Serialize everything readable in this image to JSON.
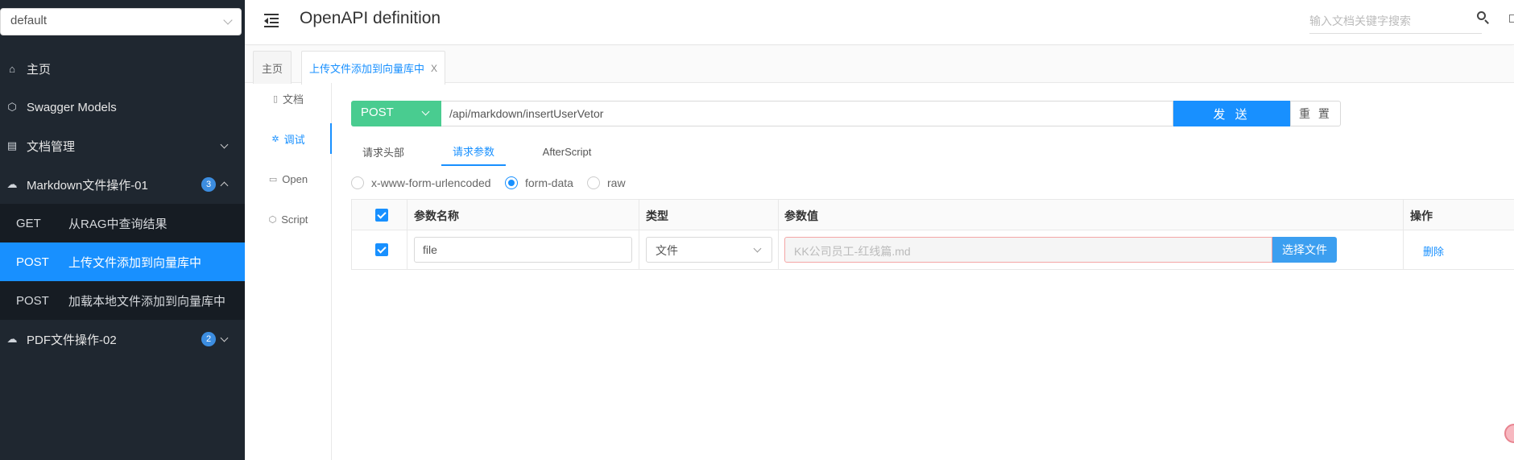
{
  "sidebar": {
    "group_select": "default",
    "menu": {
      "home": "主页",
      "swagger_models": "Swagger Models",
      "doc_manage": "文档管理",
      "markdown_group": {
        "label": "Markdown文件操作-01",
        "count": "3"
      },
      "pdf_group": {
        "label": "PDF文件操作-02",
        "count": "2"
      }
    },
    "endpoints": [
      {
        "method": "GET",
        "label": "从RAG中查询结果"
      },
      {
        "method": "POST",
        "label": "上传文件添加到向量库中"
      },
      {
        "method": "POST",
        "label": "加载本地文件添加到向量库中"
      }
    ]
  },
  "header": {
    "title": "OpenAPI definition",
    "search_placeholder": "输入文档关键字搜索"
  },
  "tabs": [
    {
      "label": "主页"
    },
    {
      "label": "上传文件添加到向量库中",
      "close": "X"
    }
  ],
  "subnav": [
    {
      "label": "文档"
    },
    {
      "label": "调试"
    },
    {
      "label": "Open"
    },
    {
      "label": "Script"
    }
  ],
  "request": {
    "method": "POST",
    "url": "/api/markdown/insertUserVetor",
    "send_label": "发 送",
    "reset_label": "重 置"
  },
  "param_tabs": [
    {
      "label": "请求头部"
    },
    {
      "label": "请求参数"
    },
    {
      "label": "AfterScript"
    }
  ],
  "content_types": [
    {
      "label": "x-www-form-urlencoded",
      "checked": false
    },
    {
      "label": "form-data",
      "checked": true
    },
    {
      "label": "raw",
      "checked": false
    }
  ],
  "params_table": {
    "headers": {
      "name": "参数名称",
      "type": "类型",
      "value": "参数值",
      "action": "操作"
    },
    "rows": [
      {
        "name": "file",
        "type": "文件",
        "value_placeholder": "KK公司员工-红线篇.md",
        "choose_label": "选择文件",
        "delete_label": "删除"
      }
    ]
  },
  "colors": {
    "sidebar_bg": "#1f2730",
    "accent": "#1890ff",
    "post_method": "#49cc90"
  }
}
